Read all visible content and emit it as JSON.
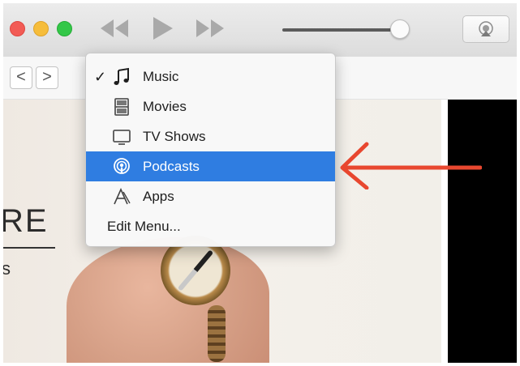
{
  "toolbar": {
    "controls": [
      "rewind-icon",
      "play-icon",
      "fast-forward-icon"
    ],
    "volume_level": 0.9,
    "airplay_icon": "airplay-icon"
  },
  "nav": {
    "back_glyph": "<",
    "forward_glyph": ">"
  },
  "banner": {
    "heading_partial": "RE",
    "subheading_partial": "s"
  },
  "menu": {
    "items": [
      {
        "label": "Music",
        "icon": "music-note-icon",
        "checked": true,
        "check_glyph": "✓"
      },
      {
        "label": "Movies",
        "icon": "film-icon",
        "checked": false
      },
      {
        "label": "TV Shows",
        "icon": "tv-icon",
        "checked": false
      },
      {
        "label": "Podcasts",
        "icon": "podcast-icon",
        "checked": false,
        "highlighted": true
      },
      {
        "label": "Apps",
        "icon": "apps-icon",
        "checked": false
      },
      {
        "label": "Edit Menu...",
        "icon": "",
        "checked": false
      }
    ]
  },
  "colors": {
    "menu_highlight": "#2f7de1",
    "annotation_arrow": "#e8472f",
    "close": "#f25b55",
    "minimize": "#f6bd3b",
    "maximize": "#33c748"
  }
}
